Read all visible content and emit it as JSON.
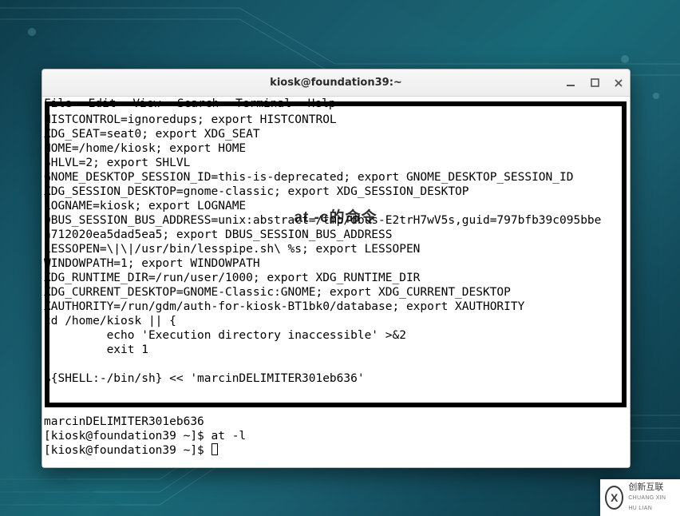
{
  "window": {
    "title": "kiosk@foundation39:~"
  },
  "menubar": {
    "items": [
      "File",
      "Edit",
      "View",
      "Search",
      "Terminal",
      "Help"
    ]
  },
  "terminal": {
    "lines": [
      "HISTCONTROL=ignoredups; export HISTCONTROL",
      "XDG_SEAT=seat0; export XDG_SEAT",
      "HOME=/home/kiosk; export HOME",
      "SHLVL=2; export SHLVL",
      "GNOME_DESKTOP_SESSION_ID=this-is-deprecated; export GNOME_DESKTOP_SESSION_ID",
      "XDG_SESSION_DESKTOP=gnome-classic; export XDG_SESSION_DESKTOP",
      "LOGNAME=kiosk; export LOGNAME",
      "DBUS_SESSION_BUS_ADDRESS=unix:abstract=/tmp/dbus-E2trH7wV5s,guid=797bfb39c095bbe",
      "a712020ea5dad5ea5; export DBUS_SESSION_BUS_ADDRESS",
      "LESSOPEN=\\|\\|/usr/bin/lesspipe.sh\\ %s; export LESSOPEN",
      "WINDOWPATH=1; export WINDOWPATH",
      "XDG_RUNTIME_DIR=/run/user/1000; export XDG_RUNTIME_DIR",
      "XDG_CURRENT_DESKTOP=GNOME-Classic:GNOME; export XDG_CURRENT_DESKTOP",
      "XAUTHORITY=/run/gdm/auth-for-kiosk-BT1bk0/database; export XAUTHORITY",
      "cd /home/kiosk || {",
      "         echo 'Execution directory inaccessible' >&2",
      "         exit 1",
      "}",
      "${SHELL:-/bin/sh} << 'marcinDELIMITER301eb636'",
      "",
      "",
      "marcinDELIMITER301eb636",
      "[kiosk@foundation39 ~]$ at -l",
      "[kiosk@foundation39 ~]$ "
    ]
  },
  "watermark": {
    "text": "at -c的命令"
  },
  "badge": {
    "icon_letter": "X",
    "cn": "创新互联",
    "en": "CHUANG XIN HU LIAN"
  }
}
